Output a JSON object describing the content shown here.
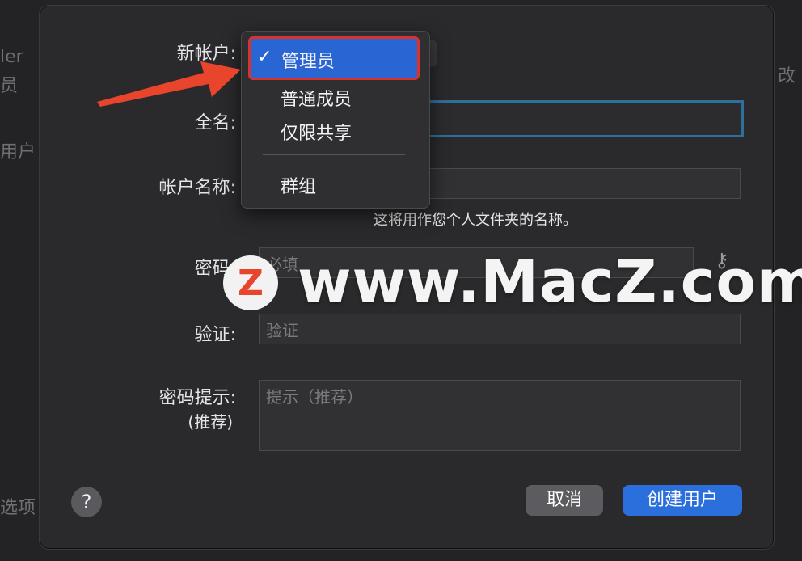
{
  "background": {
    "frag_left_1": "ler",
    "frag_left_2": "员",
    "frag_left_3": "用户",
    "frag_left_4": "选项",
    "frag_right_1": "改"
  },
  "form": {
    "account_type_label": "新帐户:",
    "full_name_label": "全名:",
    "account_name_label": "帐户名称:",
    "account_name_hint": "这将用作您个人文件夹的名称。",
    "password_label": "密码:",
    "password_placeholder": "必填",
    "verify_label": "验证:",
    "verify_placeholder": "验证",
    "hint_label": "密码提示:",
    "hint_label_sub": "(推荐)",
    "hint_placeholder": "提示（推荐）"
  },
  "menu": {
    "items": [
      {
        "label": "管理员",
        "checked": true
      },
      {
        "label": "普通成员"
      },
      {
        "label": "仅限共享"
      },
      {
        "label": "群组"
      }
    ],
    "check_glyph": "✓"
  },
  "watermark": {
    "logo_letter": "Z",
    "text": "www.MacZ.com"
  },
  "buttons": {
    "help": "?",
    "cancel": "取消",
    "create": "创建用户"
  },
  "colors": {
    "accent": "#2a6fdb",
    "highlight_border": "#d9312b",
    "arrow": "#e8452c"
  }
}
